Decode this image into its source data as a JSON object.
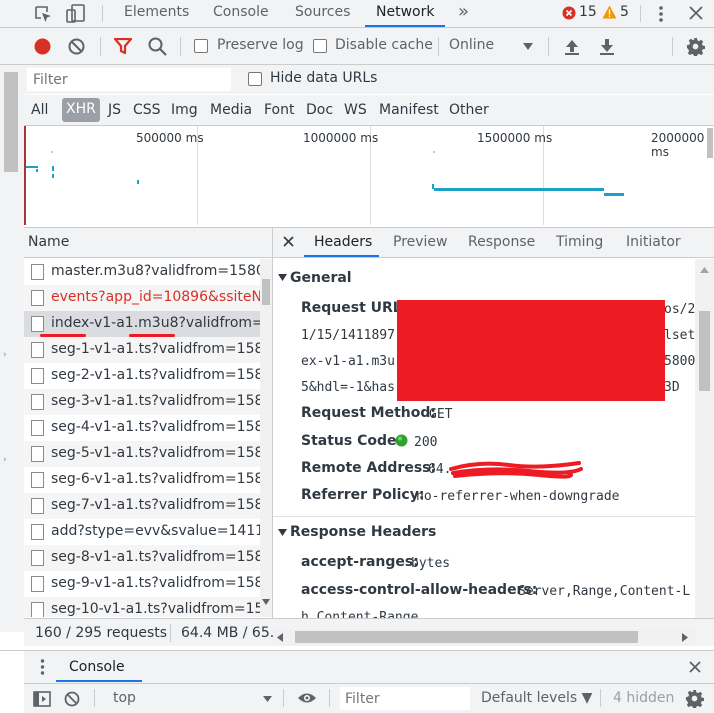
{
  "topbar": {
    "tabs": [
      "Elements",
      "Console",
      "Sources",
      "Network"
    ],
    "more_glyph": "»",
    "error_count": "15",
    "warning_count": "5"
  },
  "toolbar": {
    "preserve_log": "Preserve log",
    "disable_cache": "Disable cache",
    "throttle": "Online"
  },
  "filterbar": {
    "placeholder": "Filter",
    "hide_data_urls": "Hide data URLs"
  },
  "type_filters": [
    "All",
    "XHR",
    "JS",
    "CSS",
    "Img",
    "Media",
    "Font",
    "Doc",
    "WS",
    "Manifest",
    "Other"
  ],
  "timeline": {
    "ticks": [
      "500000 ms",
      "1000000 ms",
      "1500000 ms",
      "2000000 ms"
    ]
  },
  "requests": {
    "header": "Name",
    "rows": [
      {
        "name": "master.m3u8?validfrom=1580",
        "error": false,
        "selected": false
      },
      {
        "name": "events?app_id=10896&ssiteN",
        "error": true,
        "selected": false
      },
      {
        "name": "index-v1-a1.m3u8?validfrom=",
        "error": false,
        "selected": true
      },
      {
        "name": "seg-1-v1-a1.ts?validfrom=158",
        "error": false,
        "selected": false
      },
      {
        "name": "seg-2-v1-a1.ts?validfrom=158",
        "error": false,
        "selected": false
      },
      {
        "name": "seg-3-v1-a1.ts?validfrom=158",
        "error": false,
        "selected": false
      },
      {
        "name": "seg-4-v1-a1.ts?validfrom=158",
        "error": false,
        "selected": false
      },
      {
        "name": "seg-5-v1-a1.ts?validfrom=158",
        "error": false,
        "selected": false
      },
      {
        "name": "seg-6-v1-a1.ts?validfrom=158",
        "error": false,
        "selected": false
      },
      {
        "name": "seg-7-v1-a1.ts?validfrom=158",
        "error": false,
        "selected": false
      },
      {
        "name": "add?stype=evv&svalue=1411.",
        "error": false,
        "selected": false
      },
      {
        "name": "seg-8-v1-a1.ts?validfrom=158",
        "error": false,
        "selected": false
      },
      {
        "name": "seg-9-v1-a1.ts?validfrom=158",
        "error": false,
        "selected": false
      },
      {
        "name": "seg-10-v1-a1.ts?validfrom=15",
        "error": false,
        "selected": false
      }
    ]
  },
  "status": {
    "requests": "160 / 295 requests",
    "transferred": "64.4 MB / 65."
  },
  "details": {
    "tabs": [
      "Headers",
      "Preview",
      "Response",
      "Timing",
      "Initiator"
    ],
    "general_title": "General",
    "request_url_label": "Request URL:",
    "url_fragments": {
      "line1_left": "1/15/1411897",
      "line2_left": "ex-v1-a1.m3u",
      "line3_left": "5&hdl=-1&has",
      "line0_right": "os/2",
      "line1_right": "lset",
      "line2_right": "5800",
      "line3_right": "3D"
    },
    "request_method_label": "Request Method:",
    "request_method": "GET",
    "status_code_label": "Status Code:",
    "status_code": "200",
    "remote_address_label": "Remote Address:",
    "remote_address": "64.",
    "referrer_policy_label": "Referrer Policy:",
    "referrer_policy": "no-referrer-when-downgrade",
    "response_headers_title": "Response Headers",
    "accept_ranges_label": "accept-ranges:",
    "accept_ranges": "bytes",
    "acah_label": "access-control-allow-headers:",
    "acah_value": "Server,Range,Content-L",
    "acah_cont": "h,Content-Range"
  },
  "drawer": {
    "title": "Console",
    "context": "top",
    "filter_placeholder": "Filter",
    "levels": "Default levels ▼",
    "hidden": "4 hidden"
  },
  "colors": {
    "accent": "#1a73e8",
    "record": "#d93025",
    "redact": "#ed1c24",
    "waterfall": "#1ca0c8"
  }
}
